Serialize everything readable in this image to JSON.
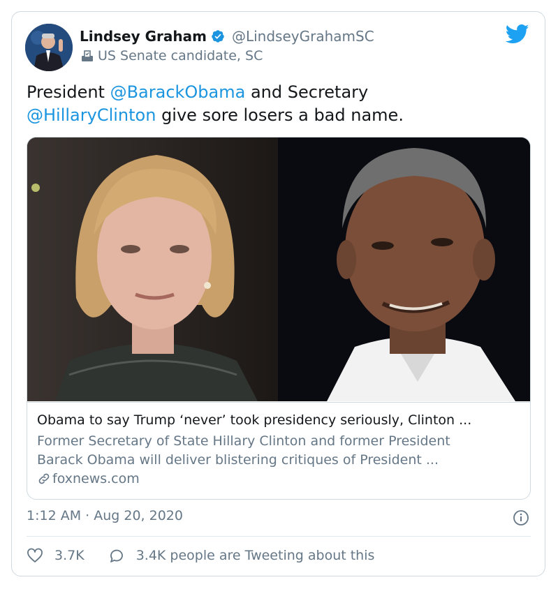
{
  "author": {
    "name": "Lindsey Graham",
    "handle": "@LindseyGrahamSC",
    "label": "US Senate candidate, SC",
    "verified": true
  },
  "tweet": {
    "text_before": "President ",
    "mention_1": "@BarackObama",
    "text_middle": " and Secretary ",
    "mention_2": "@HillaryClinton",
    "text_after": " give sore losers a bad name."
  },
  "link_card": {
    "title": "Obama to say Trump ‘never’ took presidency seriously, Clinton ...",
    "description_line_1": "Former Secretary of State Hillary Clinton and former President",
    "description_line_2": "Barack Obama will deliver blistering critiques of President ...",
    "domain": "foxnews.com",
    "images": [
      "hillary-clinton-photo",
      "barack-obama-photo"
    ]
  },
  "meta": {
    "timestamp": "1:12 AM · Aug 20, 2020"
  },
  "footer": {
    "likes": "3.7K",
    "conversation": "3.4K people are Tweeting about this"
  },
  "icons": {
    "bird": "twitter-bird-icon",
    "verified": "verified-badge-icon",
    "label": "government-ballot-icon",
    "link": "link-icon",
    "info": "info-icon",
    "like": "heart-icon",
    "reply": "speech-bubble-icon"
  },
  "colors": {
    "accent": "#1b95e0",
    "secondary_text": "#657786",
    "border": "#cfd9de"
  }
}
